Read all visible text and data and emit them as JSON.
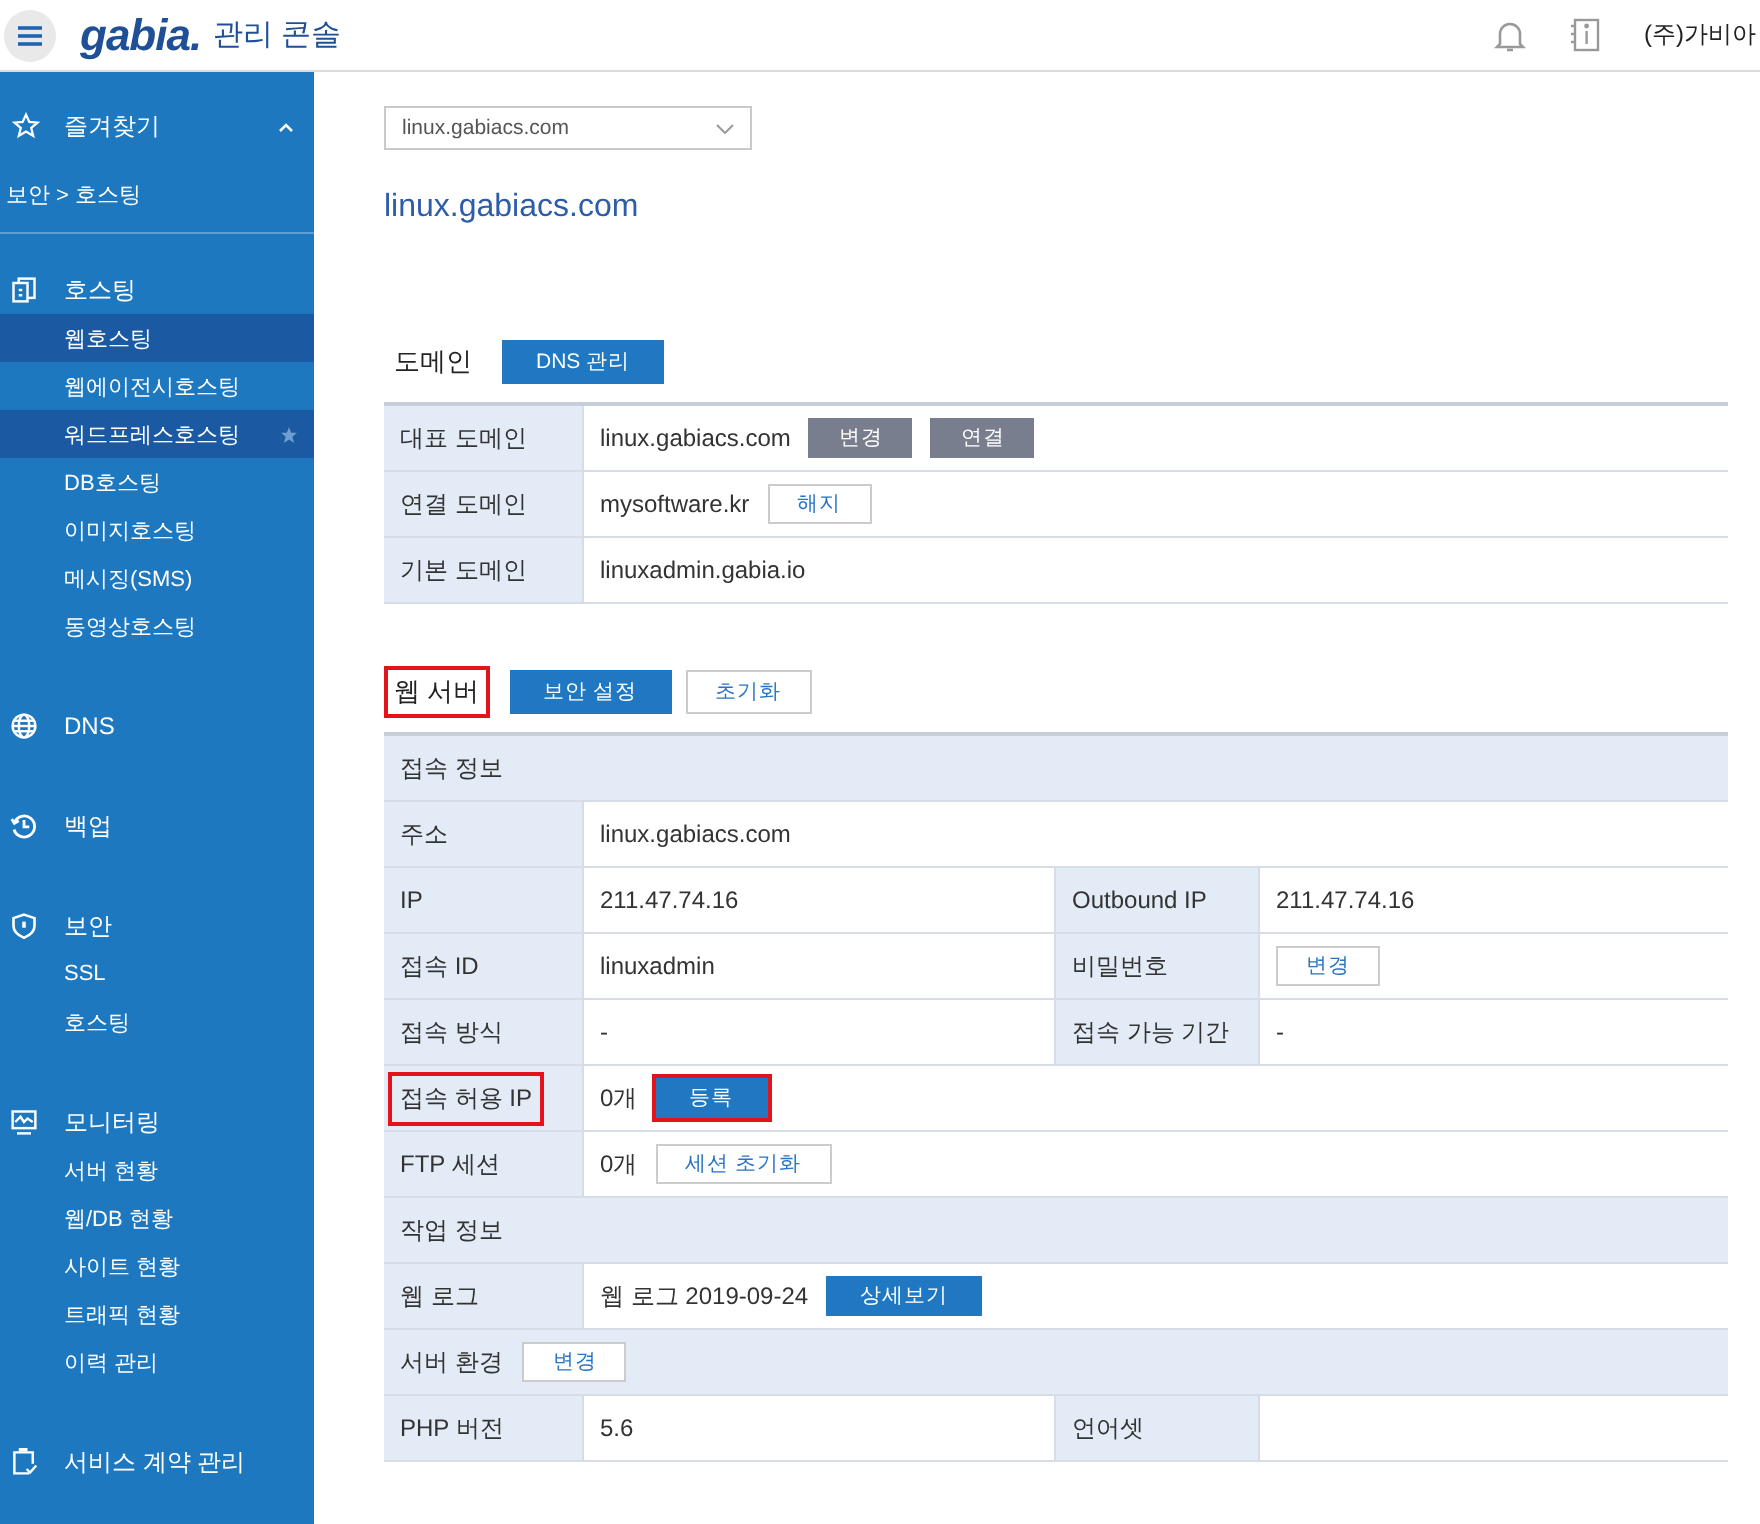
{
  "header": {
    "logo": "gabia.",
    "title": "관리 콘솔",
    "user": "(주)가비아"
  },
  "sidebar": {
    "favorites": {
      "label": "즐겨찾기",
      "expanded": true
    },
    "breadcrumb": "보안 > 호스팅",
    "groups": [
      {
        "label": "호스팅",
        "kind": "hosting",
        "items": [
          {
            "label": "웹호스팅",
            "selected": true,
            "starred": false
          },
          {
            "label": "웹에이전시호스팅",
            "selected": false,
            "starred": false
          },
          {
            "label": "워드프레스호스팅",
            "selected": true,
            "starred": true
          },
          {
            "label": "DB호스팅",
            "selected": false,
            "starred": false
          },
          {
            "label": "이미지호스팅",
            "selected": false,
            "starred": false
          },
          {
            "label": "메시징(SMS)",
            "selected": false,
            "starred": false
          },
          {
            "label": "동영상호스팅",
            "selected": false,
            "starred": false
          }
        ]
      },
      {
        "label": "DNS",
        "kind": "globe"
      },
      {
        "label": "백업",
        "kind": "history"
      },
      {
        "label": "보안",
        "kind": "shield",
        "items": [
          {
            "label": "SSL",
            "selected": false,
            "starred": false
          },
          {
            "label": "호스팅",
            "selected": false,
            "starred": false
          }
        ]
      },
      {
        "label": "모니터링",
        "kind": "monitor",
        "items": [
          {
            "label": "서버 현황",
            "selected": false,
            "starred": false
          },
          {
            "label": "웹/DB 현황",
            "selected": false,
            "starred": false
          },
          {
            "label": "사이트 현황",
            "selected": false,
            "starred": false
          },
          {
            "label": "트래픽 현황",
            "selected": false,
            "starred": false
          },
          {
            "label": "이력 관리",
            "selected": false,
            "starred": false
          }
        ]
      },
      {
        "label": "서비스 계약 관리",
        "kind": "contract"
      }
    ]
  },
  "main": {
    "site_select": {
      "value": "linux.gabiacs.com"
    },
    "site_title": "linux.gabiacs.com",
    "sections": [
      {
        "title": "도메인",
        "highlighted": false,
        "buttons": [
          {
            "label": "DNS 관리",
            "kind": "primary",
            "highlighted": false
          }
        ],
        "rows": [
          {
            "kind": "full",
            "label": "대표 도메인",
            "label_highlighted": false,
            "value": "linux.gabiacs.com",
            "buttons": [
              {
                "label": "변경",
                "kind": "gray",
                "highlighted": false
              },
              {
                "label": "연결",
                "kind": "gray",
                "highlighted": false
              }
            ]
          },
          {
            "kind": "full",
            "label": "연결 도메인",
            "label_highlighted": false,
            "value": "mysoftware.kr",
            "buttons": [
              {
                "label": "해지",
                "kind": "outline",
                "highlighted": false
              }
            ]
          },
          {
            "kind": "full",
            "label": "기본 도메인",
            "label_highlighted": false,
            "value": "linuxadmin.gabia.io"
          }
        ]
      },
      {
        "title": "웹 서버",
        "highlighted": true,
        "buttons": [
          {
            "label": "보안 설정",
            "kind": "primary",
            "highlighted": false
          },
          {
            "label": "초기화",
            "kind": "outline",
            "highlighted": false
          }
        ],
        "rows": [
          {
            "kind": "group",
            "label": "접속 정보"
          },
          {
            "kind": "full",
            "label": "주소",
            "label_highlighted": false,
            "value": "linux.gabiacs.com"
          },
          {
            "kind": "split",
            "cells": [
              {
                "label": "IP",
                "value": "211.47.74.16"
              },
              {
                "label": "Outbound IP",
                "value": "211.47.74.16"
              }
            ]
          },
          {
            "kind": "split",
            "cells": [
              {
                "label": "접속 ID",
                "value": "linuxadmin"
              },
              {
                "label": "비밀번호",
                "buttons": [
                  {
                    "label": "변경",
                    "kind": "outline",
                    "highlighted": false
                  }
                ]
              }
            ]
          },
          {
            "kind": "split",
            "cells": [
              {
                "label": "접속 방식",
                "value": "-"
              },
              {
                "label": "접속 가능 기간",
                "value": "-"
              }
            ]
          },
          {
            "kind": "full",
            "label": "접속 허용 IP",
            "label_highlighted": true,
            "value": "0개",
            "buttons": [
              {
                "label": "등록",
                "kind": "primary",
                "highlighted": true
              }
            ]
          },
          {
            "kind": "full",
            "label": "FTP 세션",
            "label_highlighted": false,
            "value": "0개",
            "buttons": [
              {
                "label": "세션 초기화",
                "kind": "outline",
                "highlighted": false
              }
            ]
          },
          {
            "kind": "group",
            "label": "작업 정보"
          },
          {
            "kind": "full",
            "label": "웹 로그",
            "label_highlighted": false,
            "value": "웹 로그 2019-09-24",
            "buttons": [
              {
                "label": "상세보기",
                "kind": "primary",
                "highlighted": false
              }
            ]
          },
          {
            "kind": "group",
            "label": "서버 환경",
            "buttons": [
              {
                "label": "변경",
                "kind": "outline",
                "highlighted": false
              }
            ]
          },
          {
            "kind": "split",
            "cells": [
              {
                "label": "PHP 버전",
                "value": "5.6"
              },
              {
                "label": "언어셋"
              }
            ]
          }
        ]
      }
    ]
  }
}
